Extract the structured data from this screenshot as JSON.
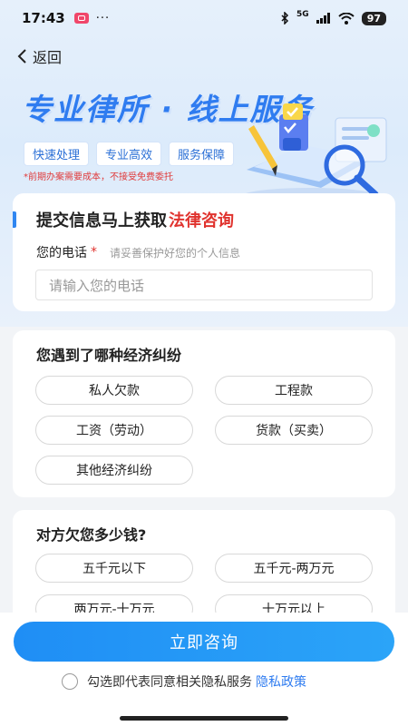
{
  "status_bar": {
    "time": "17:43",
    "dots": "···",
    "network": "5G",
    "battery": "97"
  },
  "nav": {
    "back_label": "返回"
  },
  "hero": {
    "title": "专业律所 · 线上服务",
    "tags": [
      "快速处理",
      "专业高效",
      "服务保障"
    ],
    "notice": "*前期办案需要成本，不接受免费委托"
  },
  "form": {
    "title_prefix": "提交信息马上获取",
    "title_accent": "法律咨询",
    "phone_label": "您的电话",
    "required_mark": "*",
    "phone_hint": "请妥善保护好您的个人信息",
    "phone_placeholder": "请输入您的电话"
  },
  "question1": {
    "title": "您遇到了哪种经济纠纷",
    "options": [
      "私人欠款",
      "工程款",
      "工资（劳动）",
      "货款（买卖）",
      "其他经济纠纷"
    ]
  },
  "question2": {
    "title": "对方欠您多少钱?",
    "options": [
      "五千元以下",
      "五千元-两万元",
      "两万元-十万元",
      "十万元以上"
    ]
  },
  "footer": {
    "consult_button": "立即咨询",
    "agree_text": "勾选即代表同意相关隐私服务",
    "policy_link": "隐私政策"
  },
  "colors": {
    "accent_blue": "#2f7cf0",
    "accent_red": "#e0332e",
    "button_blue": "#1f8ef5"
  }
}
